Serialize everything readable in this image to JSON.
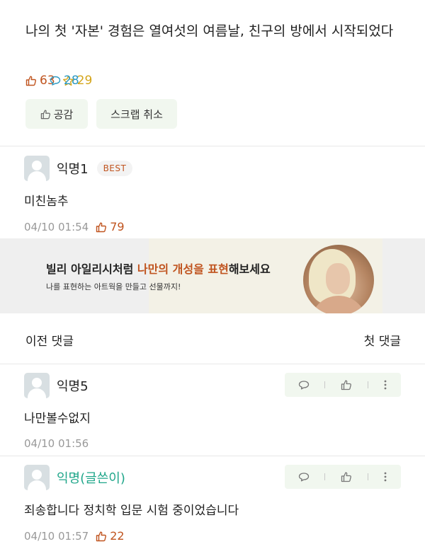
{
  "post": {
    "title": "나의 첫 '자본' 경험은 열여섯의 여름날, 친구의 방에서 시작되었다",
    "likes": "63",
    "comments": "28",
    "scraps": "29",
    "empathy_label": "공감",
    "scrap_cancel_label": "스크랩 취소"
  },
  "best_comment": {
    "author": "익명1",
    "badge": "BEST",
    "text": "미친놈추",
    "time": "04/10 01:54",
    "likes": "79"
  },
  "banner": {
    "headline_pre": "빌리 아일리시처럼 ",
    "headline_hl": "나만의 개성을 표현",
    "headline_post": "해보세요",
    "sub": "나를 표현하는 아트웍을 만들고 선물까지!"
  },
  "comment_nav": {
    "prev_label": "이전 댓글",
    "first_label": "첫 댓글"
  },
  "comments": [
    {
      "author": "익명5",
      "text": "나만볼수없지",
      "time": "04/10 01:56"
    },
    {
      "author": "익명(글쓴이)",
      "text": "죄송합니다 정치학 입문 시험 중이었습니다",
      "time": "04/10 01:57",
      "likes": "22"
    }
  ],
  "colors": {
    "like": "#c0541f",
    "comment": "#2b9ac4",
    "scrap": "#d4a51a",
    "writer": "#1fa68a",
    "tool_bg": "#f1f7ef"
  }
}
